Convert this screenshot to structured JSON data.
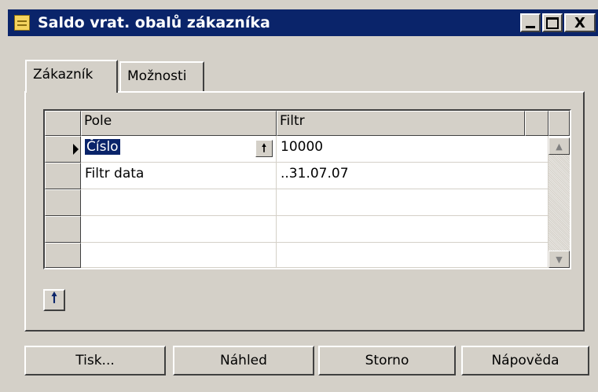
{
  "window": {
    "title": "Saldo vrat. obalů zákazníka",
    "controls": {
      "minimize": "_",
      "maximize": "□",
      "close": "X"
    }
  },
  "tabs": [
    {
      "label": "Zákazník",
      "active": true
    },
    {
      "label": "Možnosti",
      "active": false
    }
  ],
  "grid": {
    "columns": [
      "Pole",
      "Filtr"
    ],
    "rows": [
      {
        "field": "Číslo",
        "filter": "10000",
        "selected": true
      },
      {
        "field": "Filtr data",
        "filter": "..31.07.07",
        "selected": false
      },
      {
        "field": "",
        "filter": "",
        "selected": false
      },
      {
        "field": "",
        "filter": "",
        "selected": false
      },
      {
        "field": "",
        "filter": "",
        "selected": false
      }
    ]
  },
  "icons": {
    "lookup": "up-arrow-icon",
    "app": "window-icon",
    "row_pointer": "current-row-icon"
  },
  "buttons": {
    "print": "Tisk...",
    "preview": "Náhled",
    "cancel": "Storno",
    "help": "Nápověda"
  },
  "colors": {
    "titlebar": "#0a246a",
    "face": "#d4d0c8",
    "selection": "#0a246a"
  }
}
